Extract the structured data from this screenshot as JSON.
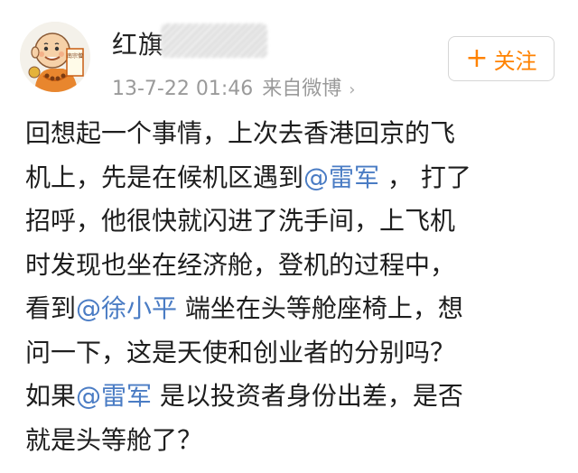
{
  "post": {
    "author": {
      "name": "红旗",
      "avatar_icon": "cartoon-monk-avatar-icon",
      "avatar_text": "南宗僧"
    },
    "timestamp": "13-7-22 01:46",
    "source": "来自微博",
    "source_chevron": "›",
    "follow_button": {
      "plus": "+",
      "label": "关注"
    },
    "accent_color": "#ff8200",
    "mention_color": "#4a7cc4",
    "content_lines": [
      [
        {
          "t": "回想起一个事情，上次去香港回京的飞"
        }
      ],
      [
        {
          "t": "机上，先是在候机区遇到"
        },
        {
          "t": "@雷军",
          "m": true
        },
        {
          "t": " ， 打了"
        }
      ],
      [
        {
          "t": "招呼，他很快就闪进了洗手间，上飞机"
        }
      ],
      [
        {
          "t": "时发现也坐在经济舱，登机的过程中，"
        }
      ],
      [
        {
          "t": "看到"
        },
        {
          "t": "@徐小平",
          "m": true
        },
        {
          "t": " 端坐在头等舱座椅上，想"
        }
      ],
      [
        {
          "t": "问一下，这是天使和创业者的分别吗？"
        }
      ],
      [
        {
          "t": "如果"
        },
        {
          "t": "@雷军",
          "m": true
        },
        {
          "t": " 是以投资者身份出差，是否"
        }
      ],
      [
        {
          "t": "就是头等舱了？"
        }
      ]
    ]
  }
}
